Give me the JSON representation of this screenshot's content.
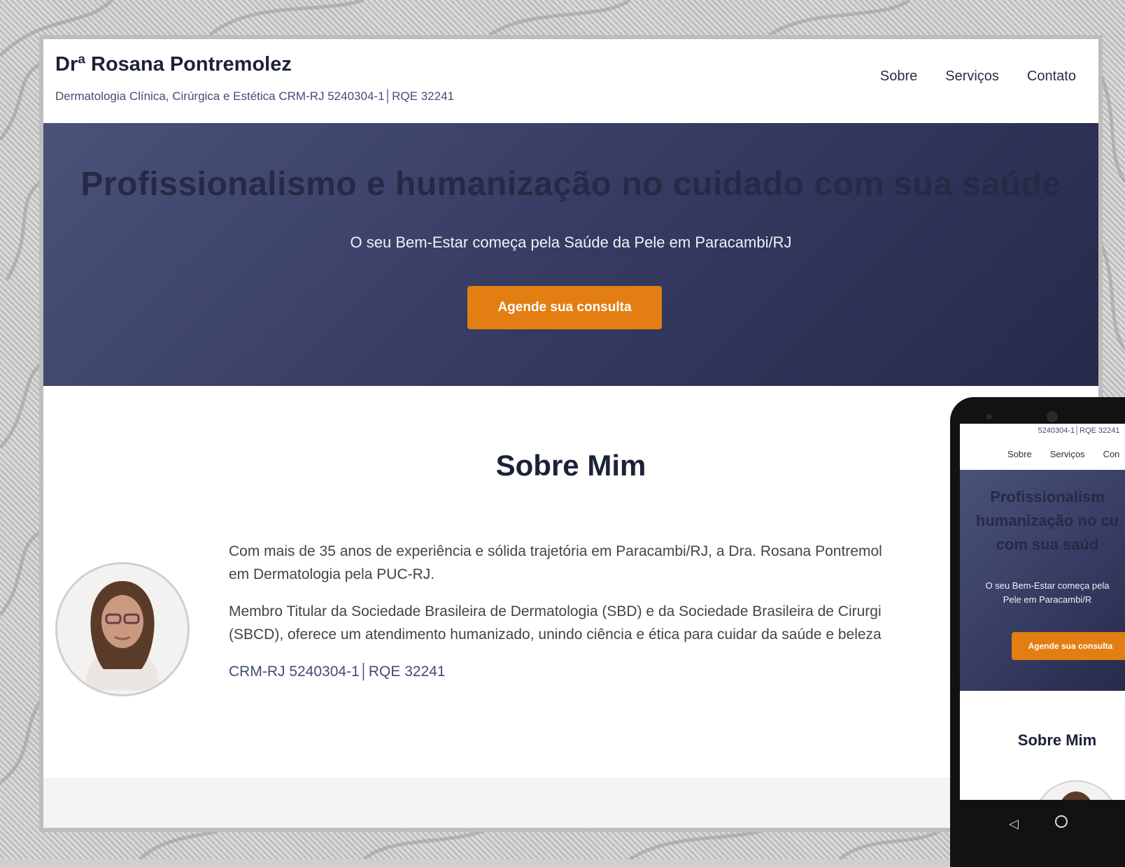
{
  "brand": {
    "name": "Drª Rosana Pontremolez",
    "subtitle": "Dermatologia Clínica, Cirúrgica e Estética CRM-RJ 5240304-1│RQE 32241"
  },
  "nav": {
    "items": [
      {
        "label": "Sobre"
      },
      {
        "label": "Serviços"
      },
      {
        "label": "Contato"
      }
    ]
  },
  "hero": {
    "title": "Profissionalismo e humanização no cuidado com sua saúde",
    "subtitle": "O seu Bem-Estar começa pela Saúde da Pele em Paracambi/RJ",
    "cta_label": "Agende sua consulta"
  },
  "about": {
    "title": "Sobre Mim",
    "paragraph1": "Com mais de 35 anos de experiência e sólida trajetória em Paracambi/RJ, a Dra. Rosana Pontremol",
    "paragraph1_cont": "em Dermatologia pela PUC-RJ.",
    "paragraph2": "Membro Titular da Sociedade Brasileira de Dermatologia (SBD) e da Sociedade Brasileira de Cirurgi",
    "paragraph2_cont": "(SBCD), oferece um atendimento humanizado, unindo ciência e ética para cuidar da saúde e beleza",
    "credentials": "CRM-RJ 5240304-1│RQE 32241"
  },
  "mobile": {
    "credentials": "5240304-1│RQE 32241",
    "nav": [
      "Sobre",
      "Serviços",
      "Con"
    ],
    "hero_title_line1": "Profissionalism",
    "hero_title_line2": "humanização no cu",
    "hero_title_line3": "com sua saúd",
    "hero_sub_line1": "O seu Bem-Estar começa pela",
    "hero_sub_line2": "Pele em Paracambi/R",
    "cta_label": "Agende sua consulta",
    "about_title": "Sobre Mim"
  },
  "colors": {
    "brand_navy": "#1b2238",
    "hero_start": "#4a5279",
    "hero_end": "#262a4a",
    "accent_orange": "#e27e12",
    "link_blue": "#434c74"
  }
}
